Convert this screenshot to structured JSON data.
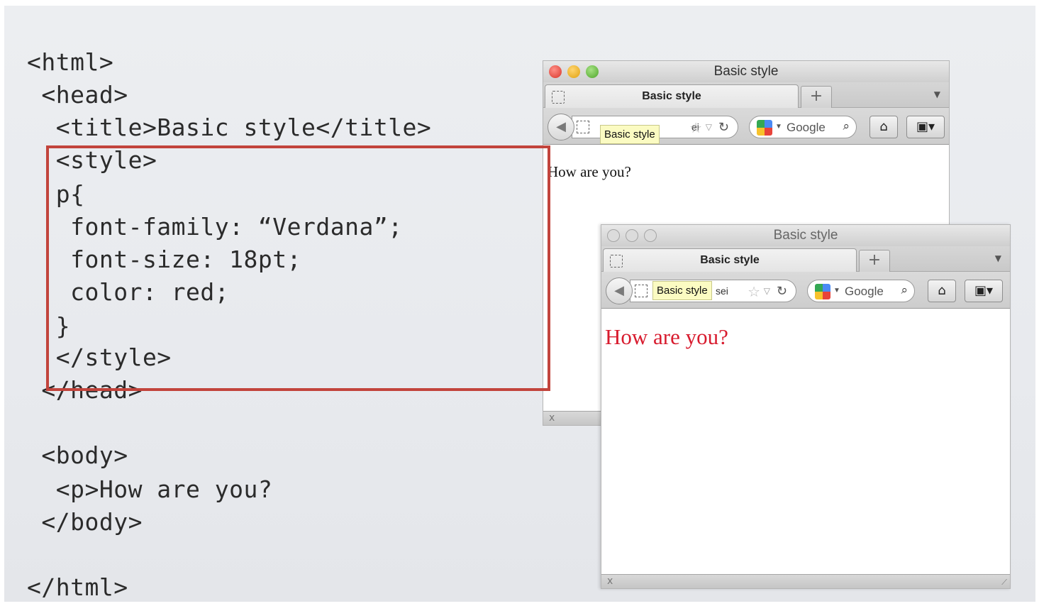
{
  "code_lines": [
    "<html>",
    " <head>",
    "  <title>Basic style</title>",
    "  <style>",
    "  p{",
    "   font-family: “Verdana”;",
    "   font-size: 18pt;",
    "   color: red;",
    "  }",
    "  </style>",
    " </head>",
    "",
    " <body>",
    "  <p>How are you?",
    " </body>",
    "",
    "</html>"
  ],
  "colors": {
    "highlight_border": "#c2443c",
    "styled_text": "#d81b2e"
  },
  "browser_back": {
    "window_title": "Basic style",
    "tab_label": "Basic style",
    "new_tab_symbol": "+",
    "url_tooltip": "Basic style",
    "url_text_fragment": "ei",
    "search_engine_label": "Google",
    "page_text": "How are you?",
    "status_close": "x",
    "traffic_lights": "active"
  },
  "browser_front": {
    "window_title": "Basic style",
    "tab_label": "Basic style",
    "new_tab_symbol": "+",
    "url_tooltip": "Basic style",
    "url_text_fragment": "sei",
    "search_engine_label": "Google",
    "page_text": "How are you?",
    "status_close": "x",
    "traffic_lights": "inactive"
  },
  "icons": {
    "back": "back-arrow-icon",
    "star": "bookmark-star-icon",
    "reload": "reload-icon",
    "search": "magnifier-icon",
    "home": "home-icon",
    "bookmarks": "bookmarks-icon"
  }
}
